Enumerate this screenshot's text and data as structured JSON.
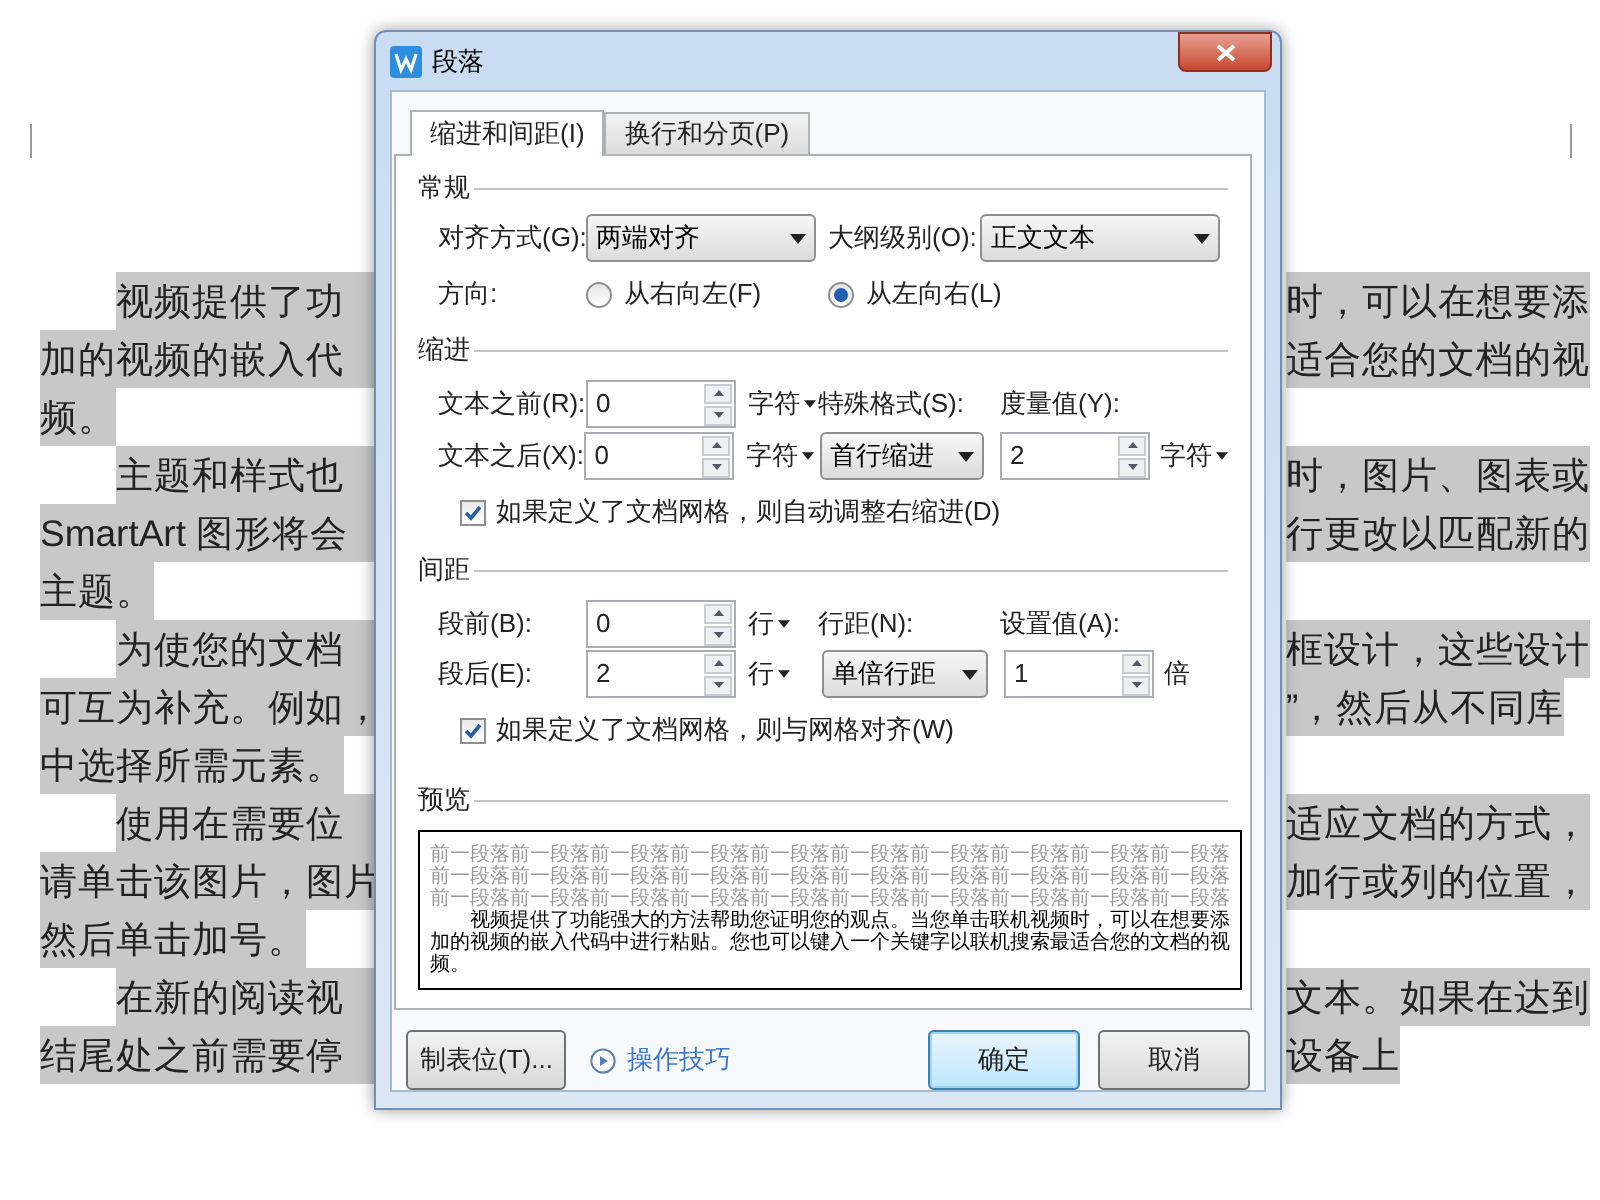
{
  "document": {
    "lines": [
      {
        "kind": "indent",
        "left": "视频提供了功",
        "right": "时，可以在想要添"
      },
      {
        "kind": "wrap",
        "left": "加的视频的嵌入代",
        "right": "适合您的文档的视"
      },
      {
        "kind": "end",
        "left": "频。"
      },
      {
        "kind": "indent",
        "left": "主题和样式也",
        "right": "时，图片、图表或"
      },
      {
        "kind": "wrap",
        "left": "SmartArt 图形将会",
        "right": "行更改以匹配新的"
      },
      {
        "kind": "end",
        "left": "主题。"
      },
      {
        "kind": "indent",
        "left": "为使您的文档",
        "right": "框设计，这些设计"
      },
      {
        "kind": "wrap",
        "left": "可互为补充。例如，",
        "right": "”，然后从不同库"
      },
      {
        "kind": "end",
        "left": "中选择所需元素。"
      },
      {
        "kind": "indent",
        "left": "使用在需要位",
        "right": "适应文档的方式，"
      },
      {
        "kind": "wrap",
        "left": "请单击该图片，图片",
        "right": "加行或列的位置，"
      },
      {
        "kind": "end",
        "left": "然后单击加号。"
      },
      {
        "kind": "indent",
        "left": "在新的阅读视",
        "right": "文本。如果在达到"
      },
      {
        "kind": "wrap",
        "left": "结尾处之前需要停",
        "right": "设备上"
      }
    ]
  },
  "dialog": {
    "title": "段落",
    "tabs": [
      {
        "label": "缩进和间距(I)",
        "selected": true
      },
      {
        "label": "换行和分页(P)",
        "selected": false
      }
    ],
    "general": {
      "heading": "常规",
      "alignment": {
        "label": "对齐方式(G):",
        "value": "两端对齐"
      },
      "outline_level": {
        "label": "大纲级别(O):",
        "value": "正文文本"
      },
      "direction": {
        "label": "方向:",
        "options": [
          {
            "label": "从右向左(F)",
            "selected": false
          },
          {
            "label": "从左向右(L)",
            "selected": true
          }
        ]
      }
    },
    "indent": {
      "heading": "缩进",
      "before": {
        "label": "文本之前(R):",
        "value": "0",
        "unit": "字符",
        "unit_dropdown": true
      },
      "after": {
        "label": "文本之后(X):",
        "value": "0",
        "unit": "字符",
        "unit_dropdown": true
      },
      "special": {
        "label": "特殊格式(S):",
        "value": "首行缩进"
      },
      "measure": {
        "label": "度量值(Y):",
        "value": "2",
        "unit": "字符",
        "unit_dropdown": true
      },
      "grid_check": {
        "label": "如果定义了文档网格，则自动调整右缩进(D)",
        "checked": true
      }
    },
    "spacing": {
      "heading": "间距",
      "before": {
        "label": "段前(B):",
        "value": "0",
        "unit": "行",
        "unit_dropdown": true
      },
      "after": {
        "label": "段后(E):",
        "value": "2",
        "unit": "行",
        "unit_dropdown": true
      },
      "line_spacing": {
        "label": "行距(N):",
        "value": "单倍行距"
      },
      "set_value": {
        "label": "设置值(A):",
        "value": "1",
        "unit": "倍",
        "unit_dropdown": false
      },
      "grid_check": {
        "label": "如果定义了文档网格，则与网格对齐(W)",
        "checked": true
      }
    },
    "preview": {
      "heading": "预览",
      "previous_lines": [
        "前一段落前一段落前一段落前一段落前一段落前一段落前一段落前一段落前一段落前一段落",
        "前一段落前一段落前一段落前一段落前一段落前一段落前一段落前一段落前一段落前一段落",
        "前一段落前一段落前一段落前一段落前一段落前一段落前一段落前一段落前一段落前一段落"
      ],
      "sample": "视频提供了功能强大的方法帮助您证明您的观点。当您单击联机视频时，可以在想要添加的视频的嵌入代码中进行粘贴。您也可以键入一个关键字以联机搜索最适合您的文档的视频。"
    },
    "buttons": {
      "tabs": "制表位(T)...",
      "tips": "操作技巧",
      "ok": "确定",
      "cancel": "取消"
    }
  }
}
